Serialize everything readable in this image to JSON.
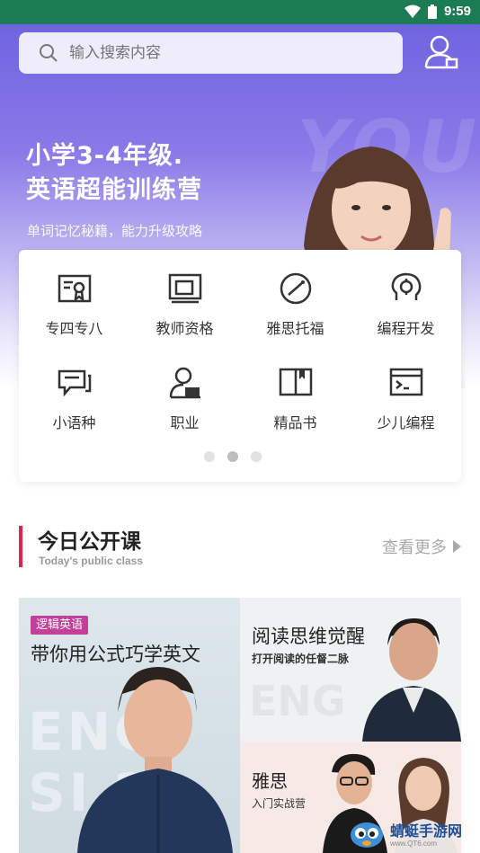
{
  "status_bar": {
    "time": "9:59"
  },
  "search": {
    "placeholder": "输入搜索内容"
  },
  "hero": {
    "title_line1": "小学3-4年级.",
    "title_line2": "英语超能训练营",
    "subtitle": "单词记忆秘籍，能力升级攻略",
    "watermark": "YOUNG"
  },
  "categories": [
    {
      "label": "专四专八",
      "icon": "certificate-icon"
    },
    {
      "label": "教师资格",
      "icon": "tablet-icon"
    },
    {
      "label": "雅思托福",
      "icon": "compass-icon"
    },
    {
      "label": "编程开发",
      "icon": "brain-icon"
    },
    {
      "label": "小语种",
      "icon": "chat-icon"
    },
    {
      "label": "职业",
      "icon": "person-laptop-icon"
    },
    {
      "label": "精品书",
      "icon": "book-icon"
    },
    {
      "label": "少儿编程",
      "icon": "terminal-icon"
    }
  ],
  "pager": {
    "count": 3,
    "active": 2
  },
  "section": {
    "title": "今日公开课",
    "subtitle_en": "Today's public class",
    "more_label": "查看更多"
  },
  "banner": {
    "left_tag": "逻辑英语",
    "left_title": "带你用公式巧学英文",
    "left_bg_text": "ENG SI 20",
    "right_top_title": "阅读思维觉醒",
    "right_top_sub": "打开阅读的任督二脉",
    "right_top_bg": "ENG",
    "right_bottom_title": "雅思",
    "right_bottom_sub": "入门实战营"
  },
  "watermark": {
    "name": "蜻蜓手游网",
    "url": "www.QT6.com"
  },
  "colors": {
    "status_bar": "#1b7b52",
    "accent": "#e2244b",
    "tag": "#c23f9a"
  }
}
